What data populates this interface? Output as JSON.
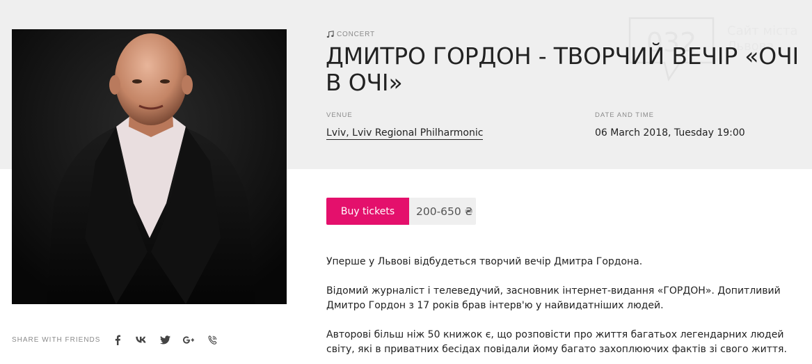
{
  "watermark": {
    "number": "032",
    "text": "Сайт міста Львова"
  },
  "event": {
    "category": "CONCERT",
    "title": "ДМИТРО ГОРДОН - ТВОРЧИЙ ВЕЧІР «ОЧІ В ОЧІ»",
    "venue_label": "VENUE",
    "venue": "Lviv, Lviv Regional Philharmonic",
    "datetime_label": "DATE AND TIME",
    "datetime": "06 March 2018, Tuesday 19:00"
  },
  "tickets": {
    "buy_label": "Buy tickets",
    "price": "200-650 ₴"
  },
  "description": [
    "Уперше у Львові відбудеться творчий вечір Дмитра Гордона.",
    "Відомий журналіст і телеведучий, засновник інтернет-видання «ГОРДОН». Допитливий Дмитро Гордон з 17 років брав інтерв'ю у найвидатніших людей.",
    "Авторові більш ніж 50 книжок є, що розповісти про життя багатьох легендарних людей світу, які в приватних бесідах повідали йому багато захоплюючих фактів зі свого життя."
  ],
  "share": {
    "label": "SHARE WITH FRIENDS",
    "icons": [
      "facebook-icon",
      "vk-icon",
      "twitter-icon",
      "google-plus-icon",
      "viber-icon"
    ]
  },
  "colors": {
    "accent": "#e4106c",
    "band": "#efefef"
  }
}
